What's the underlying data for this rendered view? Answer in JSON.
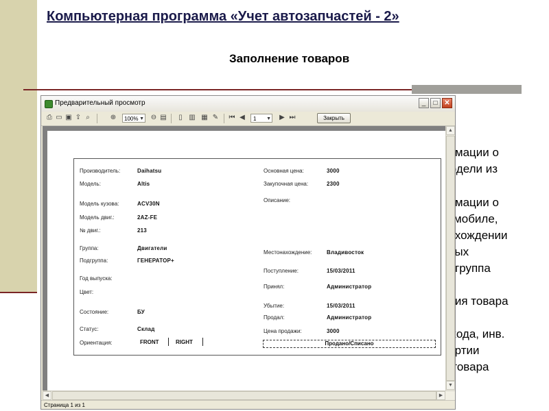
{
  "slide": {
    "title": "Компьютерная программа «Учет автозапчастей - 2»",
    "subtitle": "Заполнение товаров",
    "background_lines": [
      "ормации о",
      "модели из",
      "ормации о",
      "томобиле,",
      "нахождении",
      "вных",
      "одгруппа",
      ")",
      "ания товара",
      "х кода, инв.",
      "партии",
      "и товара"
    ]
  },
  "window": {
    "title": "Предварительный просмотр",
    "zoom": "100%",
    "page_number": "1",
    "close_button": "Закрыть",
    "status": "Страница 1 из 1"
  },
  "form": {
    "left": [
      {
        "label": "Производитель:",
        "value": "Daihatsu"
      },
      {
        "label": "Модель:",
        "value": "Altis"
      },
      {
        "label": "Модель кузова:",
        "value": "ACV30N"
      },
      {
        "label": "Модель двиг.:",
        "value": "2AZ-FE"
      },
      {
        "label": "№ двиг.:",
        "value": "213"
      },
      {
        "label": "Группа:",
        "value": "Двигатели"
      },
      {
        "label": "Подгруппа:",
        "value": "ГЕНЕРАТОР+"
      },
      {
        "label": "Год выпуска:",
        "value": ""
      },
      {
        "label": "Цвет:",
        "value": ""
      },
      {
        "label": "Состояние:",
        "value": "БУ"
      },
      {
        "label": "Статус:",
        "value": "Склад"
      },
      {
        "label": "Ориентация:",
        "value": ""
      }
    ],
    "orientation": [
      "FRONT",
      "RIGHT"
    ],
    "right": [
      {
        "label": "Основная цена:",
        "value": "3000"
      },
      {
        "label": "Закупочная цена:",
        "value": "2300"
      },
      {
        "label": "Описание:",
        "value": ""
      },
      {
        "label": "Местонахождение:",
        "value": "Владивосток"
      },
      {
        "label": "Поступление:",
        "value": "15/03/2011"
      },
      {
        "label": "Принял:",
        "value": "Администратор"
      },
      {
        "label": "Убытие:",
        "value": "15/03/2011"
      },
      {
        "label": "Продал:",
        "value": "Администратор"
      },
      {
        "label": "Цена продажи:",
        "value": "3000"
      }
    ],
    "status_box": "Продано/Списано"
  },
  "colors": {
    "sidebar": "#d8d3ad",
    "rule": "#7a2424",
    "title": "#1a1a4a"
  }
}
